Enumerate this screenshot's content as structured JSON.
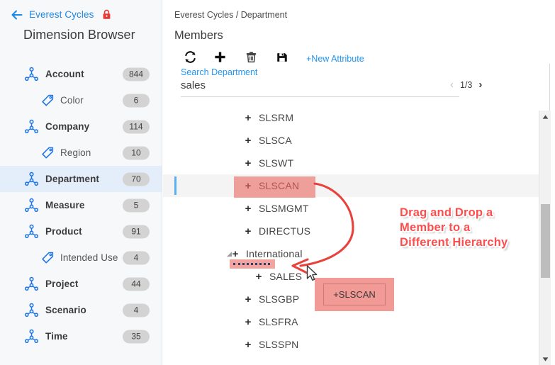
{
  "sidebar": {
    "back_icon": "back-arrow-icon",
    "brand": "Everest Cycles",
    "lock_icon": "lock-icon",
    "title": "Dimension Browser",
    "items": [
      {
        "label": "Account",
        "count": "844",
        "type": "dimension",
        "icon": "hierarchy-icon",
        "selected": false
      },
      {
        "label": "Color",
        "count": "6",
        "type": "attribute",
        "icon": "tag-icon",
        "selected": false
      },
      {
        "label": "Company",
        "count": "114",
        "type": "dimension",
        "icon": "hierarchy-icon",
        "selected": false
      },
      {
        "label": "Region",
        "count": "10",
        "type": "attribute",
        "icon": "tag-icon",
        "selected": false
      },
      {
        "label": "Department",
        "count": "70",
        "type": "dimension",
        "icon": "hierarchy-icon",
        "selected": true
      },
      {
        "label": "Measure",
        "count": "5",
        "type": "dimension",
        "icon": "hierarchy-icon",
        "selected": false
      },
      {
        "label": "Product",
        "count": "91",
        "type": "dimension",
        "icon": "hierarchy-icon",
        "selected": false
      },
      {
        "label": "Intended Use",
        "count": "4",
        "type": "attribute",
        "icon": "tag-icon",
        "selected": false
      },
      {
        "label": "Project",
        "count": "44",
        "type": "dimension",
        "icon": "hierarchy-icon",
        "selected": false
      },
      {
        "label": "Scenario",
        "count": "4",
        "type": "dimension",
        "icon": "hierarchy-icon",
        "selected": false
      },
      {
        "label": "Time",
        "count": "35",
        "type": "dimension",
        "icon": "hierarchy-icon",
        "selected": false
      }
    ]
  },
  "main": {
    "breadcrumb": "Everest Cycles / Department",
    "page_title": "Members",
    "toolbar": {
      "refresh_icon": "refresh-icon",
      "add_icon": "plus-icon",
      "delete_icon": "trash-icon",
      "save_icon": "save-icon",
      "new_attribute_label": "+New Attribute"
    },
    "search": {
      "label": "Search Department",
      "value": "sales",
      "placeholder": "Search Department"
    },
    "pager": {
      "prev_icon": "chevron-left-icon",
      "next_icon": "chevron-right-icon",
      "label": "1/3"
    },
    "tree": [
      {
        "label": "SLSRM",
        "indent": 1,
        "expandable": true,
        "caret": false,
        "selected": false,
        "highlighted": false
      },
      {
        "label": "SLSCA",
        "indent": 1,
        "expandable": true,
        "caret": false,
        "selected": false,
        "highlighted": false
      },
      {
        "label": "SLSWT",
        "indent": 1,
        "expandable": true,
        "caret": false,
        "selected": false,
        "highlighted": false
      },
      {
        "label": "SLSCAN",
        "indent": 1,
        "expandable": true,
        "caret": false,
        "selected": true,
        "highlighted": true
      },
      {
        "label": "SLSMGMT",
        "indent": 1,
        "expandable": true,
        "caret": false,
        "selected": false,
        "highlighted": false
      },
      {
        "label": "DIRECTUS",
        "indent": 1,
        "expandable": true,
        "caret": false,
        "selected": false,
        "highlighted": false
      },
      {
        "label": "International",
        "indent": 0,
        "expandable": true,
        "caret": true,
        "selected": false,
        "highlighted": false
      },
      {
        "label": "SALES",
        "indent": 2,
        "expandable": true,
        "caret": false,
        "selected": false,
        "highlighted": false
      },
      {
        "label": "SLSGBP",
        "indent": 1,
        "expandable": true,
        "caret": false,
        "selected": false,
        "highlighted": false
      },
      {
        "label": "SLSFRA",
        "indent": 1,
        "expandable": true,
        "caret": false,
        "selected": false,
        "highlighted": false
      },
      {
        "label": "SLSSPN",
        "indent": 1,
        "expandable": true,
        "caret": false,
        "selected": false,
        "highlighted": false
      }
    ],
    "expand_glyph": "+",
    "caret_glyph": "◢"
  },
  "overlay": {
    "drag_ghost_label": "+SLSCAN",
    "annotation_line1": "Drag and Drop a",
    "annotation_line2": "Member to a",
    "annotation_line3": "Different Hierarchy",
    "arrow_icon": "curved-arrow-icon",
    "cursor_icon": "mouse-cursor-icon",
    "highlight_color": "#e95950",
    "annotation_color": "#ff4d4d"
  },
  "scrollbar": {
    "up_icon": "scroll-up-arrow-icon",
    "down_icon": "scroll-down-arrow-icon",
    "thumb": "scrollbar-thumb"
  },
  "colors": {
    "accent_blue": "#2196f3",
    "selected_row": "#e4eefb",
    "badge_bg": "#d3d3d3"
  }
}
